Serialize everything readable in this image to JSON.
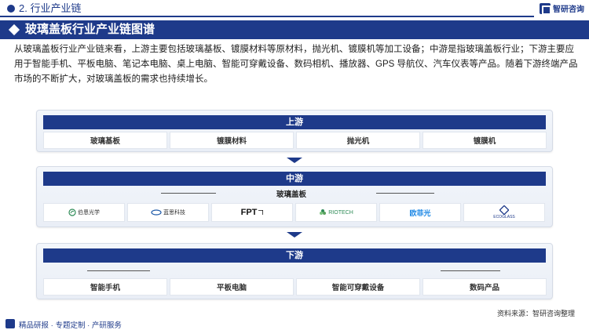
{
  "header": {
    "section": "2. 行业产业链",
    "brand": "智研咨询"
  },
  "title": "玻璃盖板行业产业链图谱",
  "intro": "从玻璃盖板行业产业链来看，上游主要包括玻璃基板、镀膜材料等原材料，抛光机、镀膜机等加工设备；中游是指玻璃盖板行业；下游主要应用于智能手机、平板电脑、笔记本电脑、桌上电脑、智能可穿戴设备、数码相机、播放器、GPS 导航仪、汽车仪表等产品。随着下游终端产品市场的不断扩大，对玻璃盖板的需求也持续增长。",
  "upstream": {
    "label": "上游",
    "items": [
      "玻璃基板",
      "镀膜材料",
      "抛光机",
      "镀膜机"
    ]
  },
  "midstream": {
    "label": "中游",
    "sub_label": "玻璃盖板",
    "logos": [
      {
        "text": "伯恩光学",
        "icon": "leaf-logo",
        "color": "#2e8b57"
      },
      {
        "text": "蓝思科技",
        "icon": "oval-logo",
        "color": "#1e5aa8"
      },
      {
        "text": "FPT",
        "icon": "fpt-logo",
        "color": "#111111"
      },
      {
        "text": "RIOTECH",
        "icon": "flower-logo",
        "color": "#2e8b57"
      },
      {
        "text": "欧菲光",
        "icon": "ofilm-logo",
        "color": "#1e88e5"
      },
      {
        "text": "ECOGLASS",
        "icon": "square-logo",
        "color": "#1e3a8a"
      }
    ]
  },
  "downstream": {
    "label": "下游",
    "items": [
      "智能手机",
      "平板电脑",
      "智能可穿戴设备",
      "数码产品"
    ]
  },
  "source": "资料来源：智研咨询整理",
  "footer": "精品研报 · 专题定制 · 产研服务"
}
